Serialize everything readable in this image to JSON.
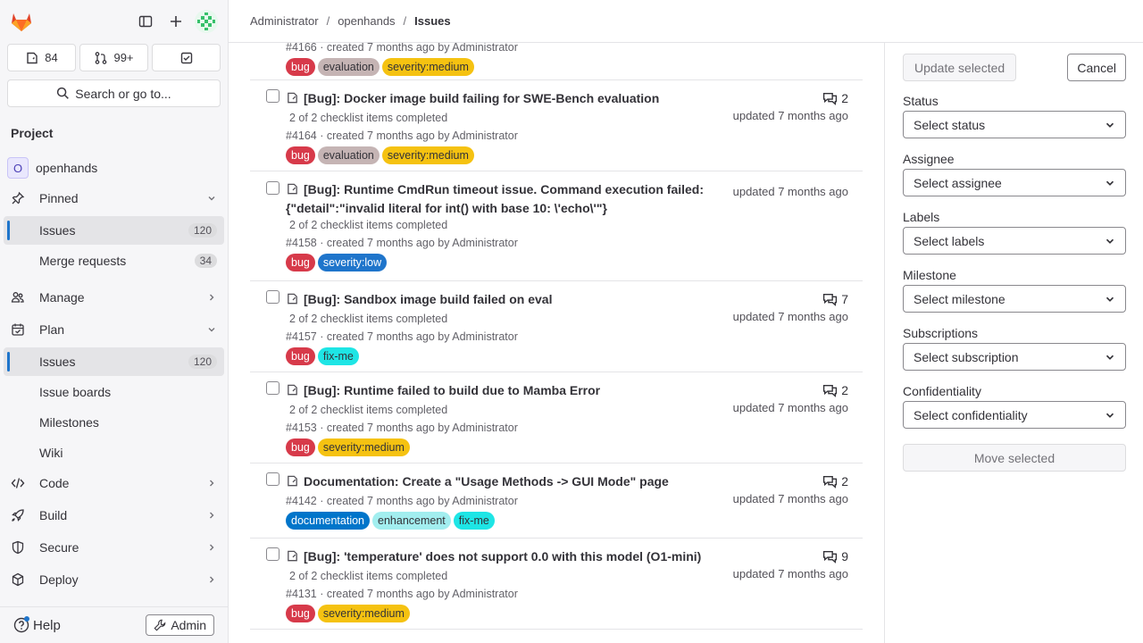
{
  "sidebar": {
    "counts": {
      "issues": "84",
      "merge_requests": "99+"
    },
    "search_label": "Search or go to...",
    "section_title": "Project",
    "project": {
      "avatar_letter": "O",
      "name": "openhands"
    },
    "pinned": {
      "label": "Pinned",
      "items": [
        {
          "label": "Issues",
          "count": "120"
        },
        {
          "label": "Merge requests",
          "count": "34"
        }
      ]
    },
    "manage": "Manage",
    "plan": {
      "label": "Plan",
      "items": [
        {
          "label": "Issues",
          "count": "120"
        },
        {
          "label": "Issue boards"
        },
        {
          "label": "Milestones"
        },
        {
          "label": "Wiki"
        }
      ]
    },
    "code": "Code",
    "build": "Build",
    "secure": "Secure",
    "deploy": "Deploy",
    "help": "Help",
    "admin": "Admin"
  },
  "breadcrumb": [
    "Administrator",
    "openhands",
    "Issues"
  ],
  "issues": [
    {
      "title": "",
      "meta": "#4166 · created 7 months ago by Administrator",
      "labels": [
        "bug",
        "evaluation",
        "severity:medium"
      ]
    },
    {
      "title": "[Bug]: Docker image build failing for SWE-Bench evaluation",
      "checklist": "2 of 2 checklist items completed",
      "meta": "#4164 · created 7 months ago by Administrator",
      "comments": "2",
      "updated": "updated 7 months ago",
      "labels": [
        "bug",
        "evaluation",
        "severity:medium"
      ]
    },
    {
      "title": "[Bug]: Runtime CmdRun timeout issue. Command execution failed: {\"detail\":\"invalid literal for int() with base 10: \\'echo\\'\"}",
      "checklist": "2 of 2 checklist items completed",
      "meta": "#4158 · created 7 months ago by Administrator",
      "updated": "updated 7 months ago",
      "labels": [
        "bug",
        "severity:low"
      ]
    },
    {
      "title": "[Bug]: Sandbox image build failed on eval",
      "checklist": "2 of 2 checklist items completed",
      "meta": "#4157 · created 7 months ago by Administrator",
      "comments": "7",
      "updated": "updated 7 months ago",
      "labels": [
        "bug",
        "fix-me"
      ]
    },
    {
      "title": "[Bug]: Runtime failed to build due to Mamba Error",
      "checklist": "2 of 2 checklist items completed",
      "meta": "#4153 · created 7 months ago by Administrator",
      "comments": "2",
      "updated": "updated 7 months ago",
      "labels": [
        "bug",
        "severity:medium"
      ]
    },
    {
      "title": "Documentation: Create a \"Usage Methods -> GUI Mode\" page",
      "meta": "#4142 · created 7 months ago by Administrator",
      "comments": "2",
      "updated": "updated 7 months ago",
      "labels": [
        "documentation",
        "enhancement",
        "fix-me"
      ]
    },
    {
      "title": "[Bug]: 'temperature' does not support 0.0 with this model (O1-mini)",
      "checklist": "2 of 2 checklist items completed",
      "meta": "#4131 · created 7 months ago by Administrator",
      "comments": "9",
      "updated": "updated 7 months ago",
      "labels": [
        "bug",
        "severity:medium"
      ]
    }
  ],
  "label_colors": {
    "bug": {
      "bg": "#d73a4a",
      "fg": "#ffffff"
    },
    "evaluation": {
      "bg": "#c5b4b4",
      "fg": "#333238"
    },
    "severity:medium": {
      "bg": "#f5c211",
      "fg": "#333238"
    },
    "severity:low": {
      "bg": "#1f75cb",
      "fg": "#ffffff"
    },
    "fix-me": {
      "bg": "#1ee5e5",
      "fg": "#333238"
    },
    "documentation": {
      "bg": "#0075ca",
      "fg": "#ffffff"
    },
    "enhancement": {
      "bg": "#a2eeef",
      "fg": "#333238"
    }
  },
  "bulk_panel": {
    "update_label": "Update selected",
    "cancel_label": "Cancel",
    "fields": [
      {
        "label": "Status",
        "placeholder": "Select status"
      },
      {
        "label": "Assignee",
        "placeholder": "Select assignee"
      },
      {
        "label": "Labels",
        "placeholder": "Select labels"
      },
      {
        "label": "Milestone",
        "placeholder": "Select milestone"
      },
      {
        "label": "Subscriptions",
        "placeholder": "Select subscription"
      },
      {
        "label": "Confidentiality",
        "placeholder": "Select confidentiality"
      }
    ],
    "move_label": "Move selected"
  }
}
